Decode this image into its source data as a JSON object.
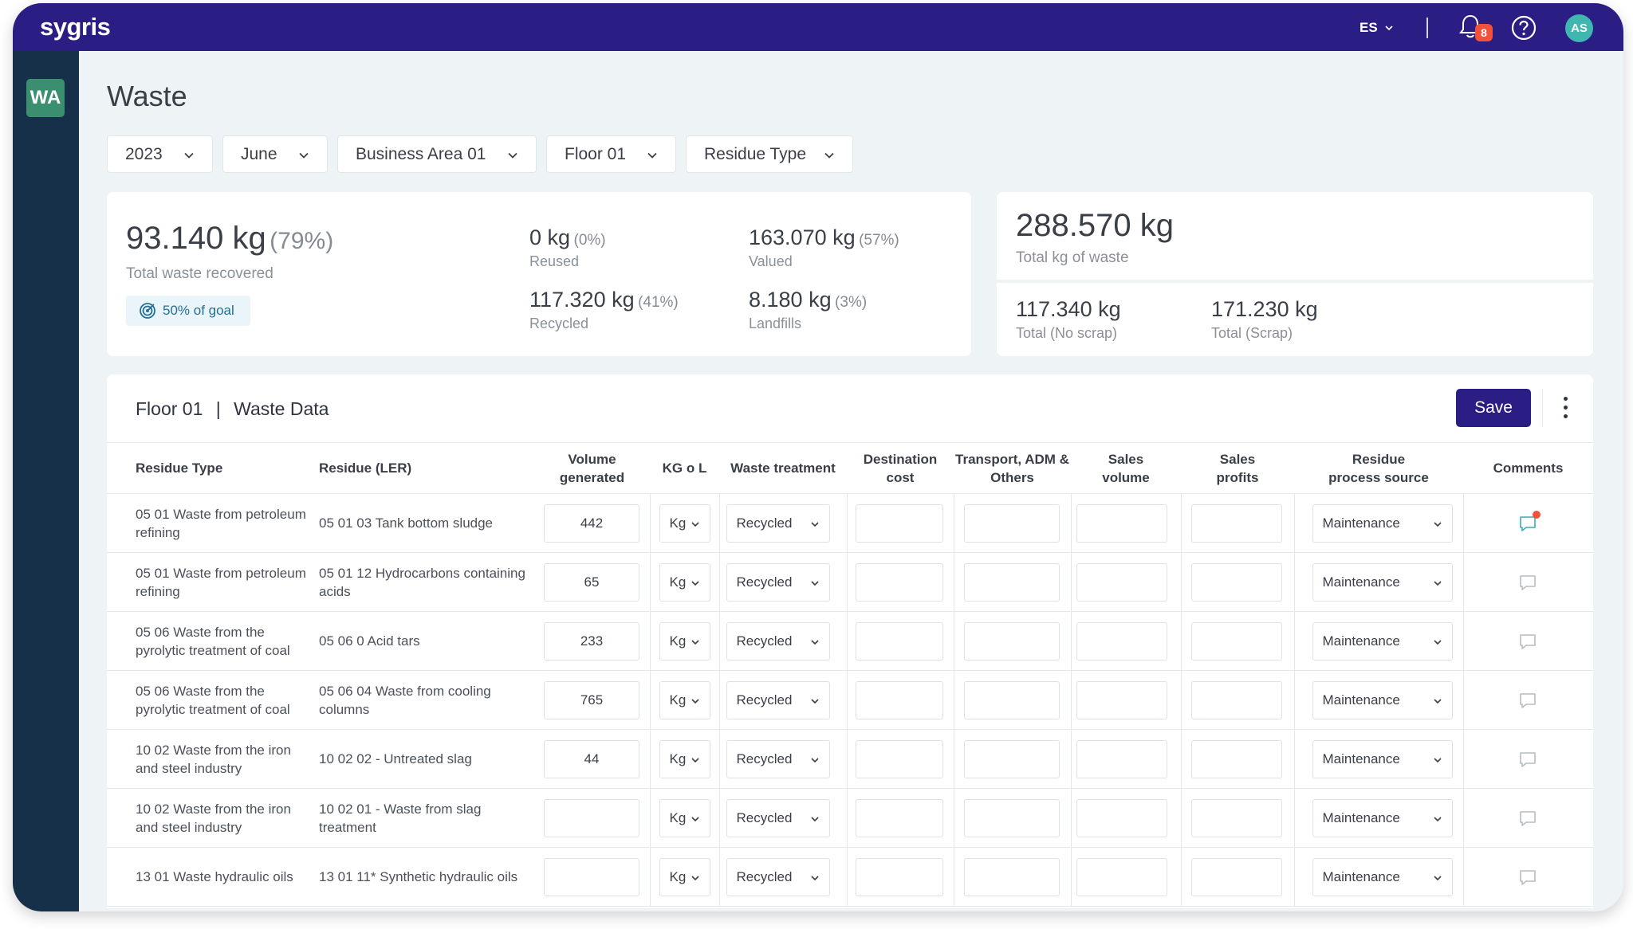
{
  "app": {
    "logo": "sygris",
    "language": "ES",
    "notifications": "8",
    "avatar_initials": "AS",
    "workspace": "WA"
  },
  "colors": {
    "brand": "#2a1d84",
    "sidebar": "#16304a",
    "workspace": "#3a8f6f",
    "alert": "#f2523a",
    "avatar": "#3fb6b0"
  },
  "page": {
    "title": "Waste"
  },
  "filters": [
    "2023",
    "June",
    "Business Area 01",
    "Floor 01",
    "Residue Type"
  ],
  "recovered": {
    "value": "93.140 kg",
    "pct": "(79%)",
    "label": "Total waste recovered",
    "goal": "50% of goal",
    "reused": {
      "value": "0 kg",
      "pct": "(0%)",
      "label": "Reused"
    },
    "valued": {
      "value": "163.070 kg",
      "pct": "(57%)",
      "label": "Valued"
    },
    "recycled": {
      "value": "117.320 kg",
      "pct": "(41%)",
      "label": "Recycled"
    },
    "landfills": {
      "value": "8.180 kg",
      "pct": "(3%)",
      "label": "Landfills"
    }
  },
  "total": {
    "value": "288.570 kg",
    "label": "Total kg of waste",
    "no_scrap": {
      "value": "117.340 kg",
      "label": "Total (No scrap)"
    },
    "scrap": {
      "value": "171.230 kg",
      "label": "Total (Scrap)"
    }
  },
  "table": {
    "floor": "Floor 01",
    "title": "Waste Data",
    "save_label": "Save",
    "headers": [
      "Residue Type",
      "Residue (LER)",
      "Volume generated",
      "KG o L",
      "Waste treatment",
      "Destination cost",
      "Transport, ADM & Others",
      "Sales volume",
      "Sales profits",
      "Residue process source",
      "Comments"
    ],
    "rows": [
      {
        "type": "05 01 Waste from petroleum refining",
        "ler": "05 01 03 Tank bottom sludge",
        "volume": "442",
        "unit": "Kg",
        "treatment": "Recycled",
        "source": "Maintenance",
        "has_comment": true
      },
      {
        "type": "05 01 Waste from petroleum refining",
        "ler": "05 01 12 Hydrocarbons containing acids",
        "volume": "65",
        "unit": "Kg",
        "treatment": "Recycled",
        "source": "Maintenance",
        "has_comment": false
      },
      {
        "type": "05 06 Waste from the pyrolytic treatment of coal",
        "ler": "05 06 0 Acid tars",
        "volume": "233",
        "unit": "Kg",
        "treatment": "Recycled",
        "source": "Maintenance",
        "has_comment": false
      },
      {
        "type": "05 06 Waste from the pyrolytic treatment of coal",
        "ler": "05 06 04 Waste from cooling columns",
        "volume": "765",
        "unit": "Kg",
        "treatment": "Recycled",
        "source": "Maintenance",
        "has_comment": false
      },
      {
        "type": "10 02 Waste from the iron and steel industry",
        "ler": "10 02 02 - Untreated slag",
        "volume": "44",
        "unit": "Kg",
        "treatment": "Recycled",
        "source": "Maintenance",
        "has_comment": false
      },
      {
        "type": "10 02 Waste from the iron and steel industry",
        "ler": "10 02 01 - Waste from slag treatment",
        "volume": "",
        "unit": "Kg",
        "treatment": "Recycled",
        "source": "Maintenance",
        "has_comment": false
      },
      {
        "type": "13 01 Waste hydraulic oils",
        "ler": "13 01 11* Synthetic hydraulic oils",
        "volume": "",
        "unit": "Kg",
        "treatment": "Recycled",
        "source": "Maintenance",
        "has_comment": false
      }
    ]
  }
}
